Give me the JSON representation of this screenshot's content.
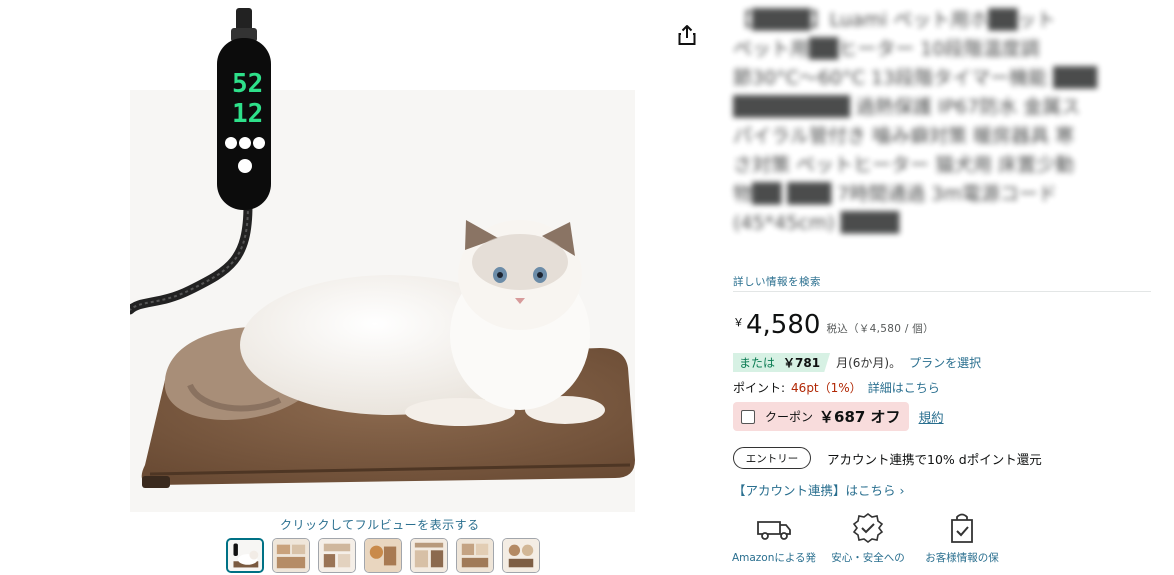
{
  "gallery": {
    "click_hint": "クリックしてフルビューを表示する",
    "controller_readout": {
      "temp": "52",
      "timer": "12"
    },
    "thumbnail_count": 7
  },
  "title": {
    "lines": [
      "【████】Luami ペット用ホ██ット",
      "ペット用██ヒーター 10段階温度調",
      "節30°C～60°C 13段階タイマー機能 ███",
      "████████ 過熱保護 IP67防水 金属ス",
      "パイラル管付き 噛み癖対策 暖房器具 寒",
      "さ対策 ペットヒーター 猫犬用 床置少動",
      "物██ ███ 7時間通過 3m電源コード",
      "(45*45cm) ████"
    ]
  },
  "details_link": "詳しい情報を検索",
  "price": {
    "currency": "￥",
    "amount": "4,580",
    "tax_note": "税込（￥4,580 / 個）"
  },
  "installment": {
    "prefix": "または",
    "amount": "￥781",
    "term": "月(6か月)。",
    "plan_link": "プランを選択"
  },
  "points": {
    "label": "ポイント:",
    "value": "46pt（1%）",
    "link": "詳細はこちら"
  },
  "coupon": {
    "label": "クーポン",
    "amount": "￥687 オフ",
    "terms": "規約"
  },
  "entry": {
    "button": "エントリー",
    "text": "アカウント連携で10% dポイント還元"
  },
  "account_link": "【アカウント連携】はこちら ›",
  "features": [
    {
      "icon": "truck-icon",
      "label": "Amazonによる発"
    },
    {
      "icon": "shield-badge-icon",
      "label": "安心・安全への"
    },
    {
      "icon": "secure-bag-icon",
      "label": "お客様情報の保"
    }
  ],
  "colors": {
    "link": "#2a6f8f",
    "install_bg": "#d7f1e4",
    "coupon_bg": "#f8dcdc",
    "points": "#b12704",
    "led_green": "#2ee08a"
  }
}
